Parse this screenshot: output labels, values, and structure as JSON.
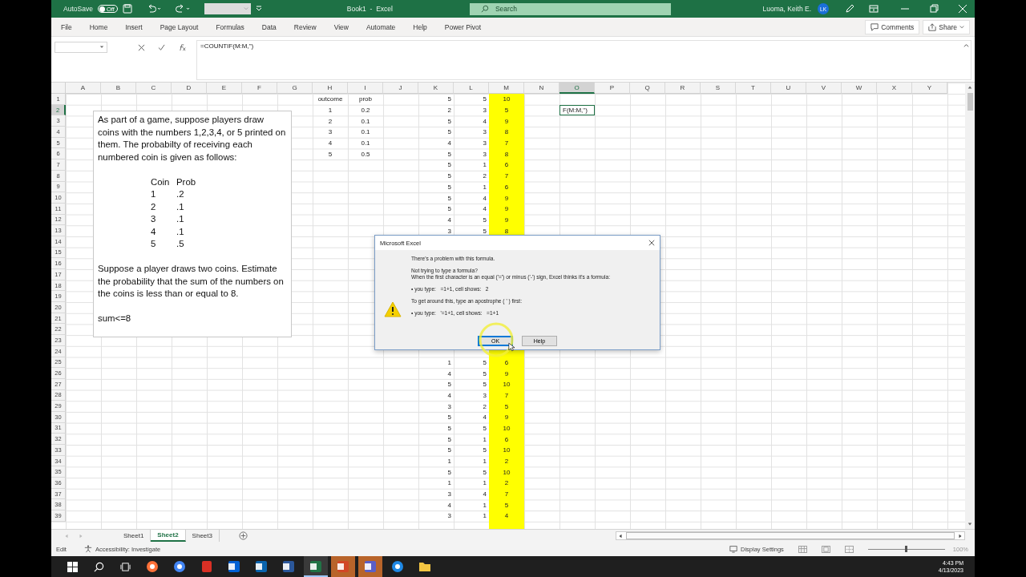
{
  "title_bar": {
    "autosave_label": "AutoSave",
    "autosave": {
      "on": false,
      "text": "Off"
    },
    "title": "Book1  -  Excel",
    "search_placeholder": "Search",
    "user_name": "Luoma, Keith E.",
    "avatar_initials": "LK"
  },
  "ribbon_tabs": [
    "File",
    "Home",
    "Insert",
    "Page Layout",
    "Formulas",
    "Data",
    "Review",
    "View",
    "Automate",
    "Help",
    "Power Pivot"
  ],
  "ribbon_actions": {
    "comments": "Comments",
    "share": "Share"
  },
  "formula_bar": {
    "formula": "=COUNTIF(M:M,\")"
  },
  "columns": [
    {
      "label": "A",
      "selected": false,
      "highlighted": false
    },
    {
      "label": "B",
      "selected": false,
      "highlighted": false
    },
    {
      "label": "C",
      "selected": false,
      "highlighted": false
    },
    {
      "label": "D",
      "selected": false,
      "highlighted": false
    },
    {
      "label": "E",
      "selected": false,
      "highlighted": false
    },
    {
      "label": "F",
      "selected": false,
      "highlighted": false
    },
    {
      "label": "G",
      "selected": false,
      "highlighted": false
    },
    {
      "label": "H",
      "selected": false,
      "highlighted": false,
      "centered": true
    },
    {
      "label": "I",
      "selected": false,
      "highlighted": false,
      "centered": true
    },
    {
      "label": "J",
      "selected": false,
      "highlighted": false
    },
    {
      "label": "K",
      "selected": false,
      "highlighted": false,
      "centered": false
    },
    {
      "label": "L",
      "selected": false,
      "highlighted": false,
      "centered": false
    },
    {
      "label": "M",
      "selected": false,
      "highlighted": true,
      "centered": true
    },
    {
      "label": "N",
      "selected": false,
      "highlighted": false
    },
    {
      "label": "O",
      "selected": true,
      "highlighted": false
    },
    {
      "label": "P",
      "selected": false,
      "highlighted": false
    },
    {
      "label": "Q",
      "selected": false,
      "highlighted": false
    },
    {
      "label": "R",
      "selected": false,
      "highlighted": false
    },
    {
      "label": "S",
      "selected": false,
      "highlighted": false
    },
    {
      "label": "T",
      "selected": false,
      "highlighted": false
    },
    {
      "label": "U",
      "selected": false,
      "highlighted": false
    },
    {
      "label": "V",
      "selected": false,
      "highlighted": false
    },
    {
      "label": "W",
      "selected": false,
      "highlighted": false
    },
    {
      "label": "X",
      "selected": false,
      "highlighted": false
    },
    {
      "label": "Y",
      "selected": false,
      "highlighted": false
    }
  ],
  "rows": [
    {
      "label": "1",
      "selected": false,
      "cells": {
        "H": "outcome",
        "I": "prob",
        "K": "5",
        "L": "5",
        "M": "10"
      }
    },
    {
      "label": "2",
      "selected": true,
      "cells": {
        "H": "1",
        "I": "0.2",
        "K": "2",
        "L": "3",
        "M": "5",
        "O": {
          "text": "F(M:M,\")",
          "editing": true
        }
      }
    },
    {
      "label": "3",
      "selected": false,
      "cells": {
        "H": "2",
        "I": "0.1",
        "K": "5",
        "L": "4",
        "M": "9"
      }
    },
    {
      "label": "4",
      "selected": false,
      "cells": {
        "H": "3",
        "I": "0.1",
        "K": "5",
        "L": "3",
        "M": "8"
      }
    },
    {
      "label": "5",
      "selected": false,
      "cells": {
        "H": "4",
        "I": "0.1",
        "K": "4",
        "L": "3",
        "M": "7"
      }
    },
    {
      "label": "6",
      "selected": false,
      "cells": {
        "H": "5",
        "I": "0.5",
        "K": "5",
        "L": "3",
        "M": "8"
      }
    },
    {
      "label": "7",
      "selected": false,
      "cells": {
        "K": "5",
        "L": "1",
        "M": "6"
      }
    },
    {
      "label": "8",
      "selected": false,
      "cells": {
        "K": "5",
        "L": "2",
        "M": "7"
      }
    },
    {
      "label": "9",
      "selected": false,
      "cells": {
        "K": "5",
        "L": "1",
        "M": "6"
      }
    },
    {
      "label": "10",
      "selected": false,
      "cells": {
        "K": "5",
        "L": "4",
        "M": "9"
      }
    },
    {
      "label": "11",
      "selected": false,
      "cells": {
        "K": "5",
        "L": "4",
        "M": "9"
      }
    },
    {
      "label": "12",
      "selected": false,
      "cells": {
        "K": "4",
        "L": "5",
        "M": "9"
      }
    },
    {
      "label": "13",
      "selected": false,
      "cells": {
        "K": "3",
        "L": "5",
        "M": "8"
      }
    },
    {
      "label": "14",
      "selected": false
    },
    {
      "label": "15",
      "selected": false
    },
    {
      "label": "16",
      "selected": false
    },
    {
      "label": "17",
      "selected": false
    },
    {
      "label": "18",
      "selected": false
    },
    {
      "label": "19",
      "selected": false
    },
    {
      "label": "20",
      "selected": false
    },
    {
      "label": "21",
      "selected": false
    },
    {
      "label": "22",
      "selected": false
    },
    {
      "label": "23",
      "selected": false
    },
    {
      "label": "24",
      "selected": false
    },
    {
      "label": "25",
      "selected": false,
      "cells": {
        "K": "1",
        "L": "5",
        "M": "6"
      }
    },
    {
      "label": "26",
      "selected": false,
      "cells": {
        "K": "4",
        "L": "5",
        "M": "9"
      }
    },
    {
      "label": "27",
      "selected": false,
      "cells": {
        "K": "5",
        "L": "5",
        "M": "10"
      }
    },
    {
      "label": "28",
      "selected": false,
      "cells": {
        "K": "4",
        "L": "3",
        "M": "7"
      }
    },
    {
      "label": "29",
      "selected": false,
      "cells": {
        "K": "3",
        "L": "2",
        "M": "5"
      }
    },
    {
      "label": "30",
      "selected": false,
      "cells": {
        "K": "5",
        "L": "4",
        "M": "9"
      }
    },
    {
      "label": "31",
      "selected": false,
      "cells": {
        "K": "5",
        "L": "5",
        "M": "10"
      }
    },
    {
      "label": "32",
      "selected": false,
      "cells": {
        "K": "5",
        "L": "1",
        "M": "6"
      }
    },
    {
      "label": "33",
      "selected": false,
      "cells": {
        "K": "5",
        "L": "5",
        "M": "10"
      }
    },
    {
      "label": "34",
      "selected": false,
      "cells": {
        "K": "1",
        "L": "1",
        "M": "2"
      }
    },
    {
      "label": "35",
      "selected": false,
      "cells": {
        "K": "5",
        "L": "5",
        "M": "10"
      }
    },
    {
      "label": "36",
      "selected": false,
      "cells": {
        "K": "1",
        "L": "1",
        "M": "2"
      }
    },
    {
      "label": "37",
      "selected": false,
      "cells": {
        "K": "3",
        "L": "4",
        "M": "7"
      }
    },
    {
      "label": "38",
      "selected": false,
      "cells": {
        "K": "4",
        "L": "1",
        "M": "5"
      }
    },
    {
      "label": "39",
      "selected": false,
      "cells": {
        "K": "3",
        "L": "1",
        "M": "4"
      }
    }
  ],
  "text_box": {
    "intro": "As part of a game, suppose players draw coins with the numbers 1,2,3,4, or 5 printed on them. The probabilty of receiving each numbered coin is given as follows:",
    "coin_table": {
      "headers": [
        "Coin",
        "Prob"
      ],
      "rows": [
        [
          "1",
          ".2"
        ],
        [
          "2",
          ".1"
        ],
        [
          "3",
          ".1"
        ],
        [
          "4",
          ".1"
        ],
        [
          "5",
          ".5"
        ]
      ]
    },
    "question": "Suppose a player draws two coins. Estimate the probability that the sum of the numbers on the coins is less than or equal to 8.",
    "note": "sum<=8"
  },
  "dialog": {
    "title": "Microsoft Excel",
    "blocks": [
      [
        "There's a problem with this formula."
      ],
      [
        "Not trying to type a formula?",
        "When the first character is an equal ('=') or minus ('-') sign, Excel thinks it's a formula:"
      ],
      [
        "• you type:   =1+1, cell shows:   2"
      ],
      [
        "To get around this, type an apostrophe ( ' ) first:"
      ],
      [
        "• you type:   '=1+1, cell shows:   =1+1"
      ]
    ],
    "buttons": [
      {
        "label": "OK",
        "selected": true
      },
      {
        "label": "Help",
        "selected": false
      }
    ]
  },
  "sheet_tabs": [
    {
      "label": "Sheet1",
      "selected": false
    },
    {
      "label": "Sheet2",
      "selected": true
    },
    {
      "label": "Sheet3",
      "selected": false
    }
  ],
  "status_bar": {
    "mode": "Edit",
    "accessibility": "Accessibility: Investigate",
    "display_settings": "Display Settings",
    "zoom": {
      "label": "100%",
      "level": 0.5
    }
  },
  "taskbar": {
    "apps": [
      {
        "kind": "firefox",
        "selected": false,
        "flashing": false
      },
      {
        "kind": "chrome",
        "selected": false,
        "flashing": false
      },
      {
        "kind": "red",
        "selected": false,
        "flashing": false
      },
      {
        "kind": "box",
        "selected": false,
        "flashing": false
      },
      {
        "kind": "mail",
        "selected": false,
        "flashing": false
      },
      {
        "kind": "word",
        "selected": false,
        "flashing": false
      },
      {
        "kind": "excel",
        "selected": true,
        "flashing": false
      },
      {
        "kind": "slides",
        "selected": false,
        "flashing": true
      },
      {
        "kind": "teams",
        "selected": false,
        "flashing": true
      },
      {
        "kind": "gear",
        "selected": false,
        "flashing": false
      },
      {
        "kind": "folder",
        "selected": false,
        "flashing": false
      }
    ],
    "time": "4:43 PM",
    "date": "4/13/2023"
  }
}
